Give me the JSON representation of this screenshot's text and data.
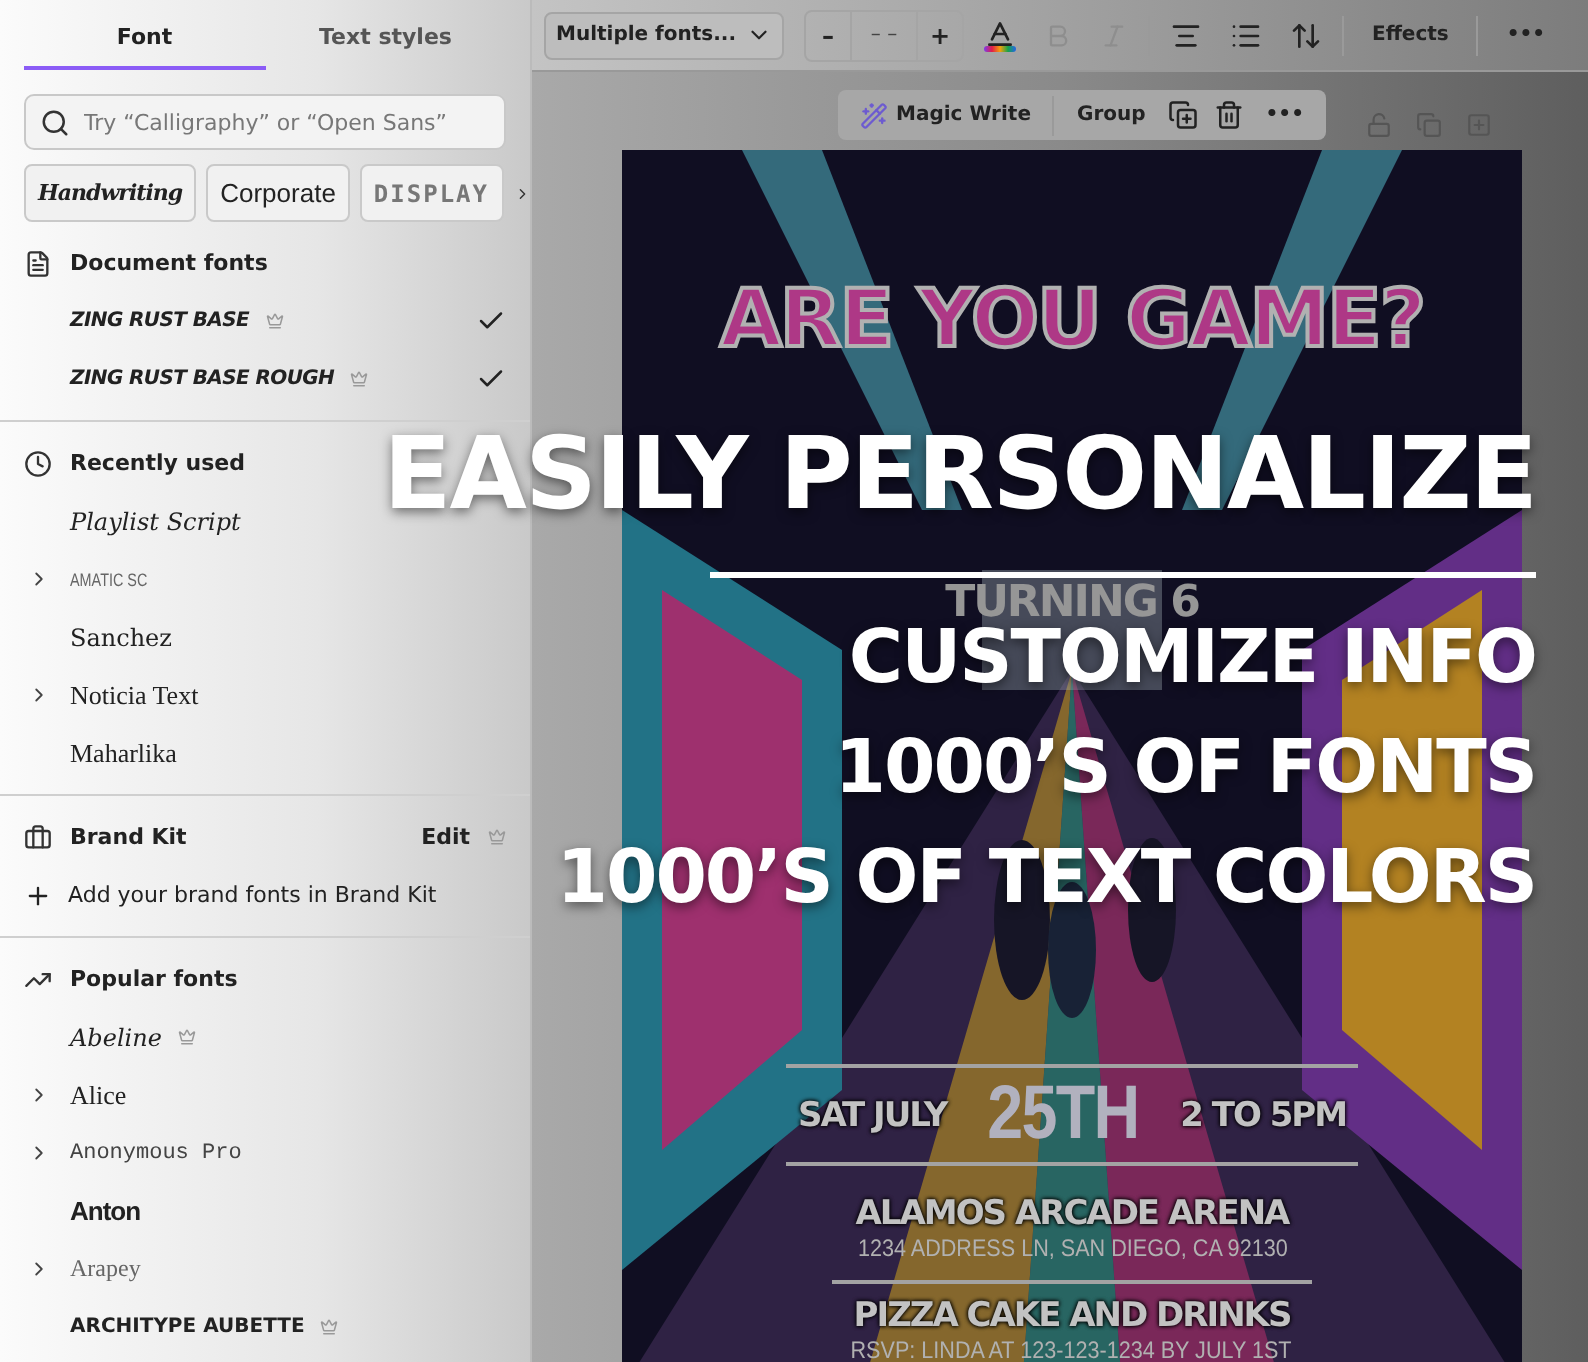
{
  "font_panel": {
    "tabs": [
      {
        "label": "Font",
        "selected": true
      },
      {
        "label": "Text styles",
        "selected": false
      }
    ],
    "search": {
      "placeholder": "Try “Calligraphy” or “Open Sans”"
    },
    "style_chips": [
      {
        "label": "Handwriting",
        "kind": "script"
      },
      {
        "label": "Corporate",
        "kind": "sans"
      },
      {
        "label": "DISPLAY",
        "kind": "display"
      }
    ],
    "sections": [
      {
        "kind": "document",
        "title": "Document fonts",
        "fonts": [
          {
            "name": "ZING RUST BASE",
            "kind": "bold-italic",
            "expandable": false,
            "premium": true,
            "checked": true
          },
          {
            "name": "ZING RUST BASE ROUGH",
            "kind": "bold-italic",
            "expandable": false,
            "premium": true,
            "checked": true
          }
        ]
      },
      {
        "kind": "recent",
        "title": "Recently used",
        "fonts": [
          {
            "name": "Playlist Script",
            "kind": "script",
            "expandable": false,
            "premium": false,
            "checked": false
          },
          {
            "name": "AMATIC SC",
            "kind": "caps-thin",
            "expandable": true,
            "premium": false,
            "checked": false
          },
          {
            "name": "Sanchez",
            "kind": "slab",
            "expandable": false,
            "premium": false,
            "checked": false
          },
          {
            "name": "Noticia Text",
            "kind": "serif",
            "expandable": true,
            "premium": false,
            "checked": false
          },
          {
            "name": "Maharlika",
            "kind": "serif",
            "expandable": false,
            "premium": false,
            "checked": false
          }
        ]
      },
      {
        "kind": "brand",
        "title": "Brand Kit",
        "action": "Edit",
        "action_premium": true,
        "add_label": "Add your brand fonts in Brand Kit"
      },
      {
        "kind": "popular",
        "title": "Popular fonts",
        "fonts": [
          {
            "name": "Abeline",
            "kind": "script",
            "expandable": false,
            "premium": true,
            "checked": false
          },
          {
            "name": "Alice",
            "kind": "serif",
            "expandable": true,
            "premium": false,
            "checked": false
          },
          {
            "name": "Anonymous Pro",
            "kind": "mono",
            "expandable": true,
            "premium": false,
            "checked": false
          },
          {
            "name": "Anton",
            "kind": "condensed",
            "expandable": false,
            "premium": false,
            "checked": false
          },
          {
            "name": "Arapey",
            "kind": "light-serif",
            "expandable": true,
            "premium": false,
            "checked": false
          },
          {
            "name": "ARCHITYPE AUBETTE",
            "kind": "display",
            "expandable": false,
            "premium": true,
            "checked": false
          }
        ]
      }
    ]
  },
  "toolbar": {
    "font_dropdown": "Multiple fonts...",
    "size_minus": "–",
    "size": {
      "placeholder": "– –"
    },
    "size_plus": "+",
    "tools": [
      {
        "kind": "text-color",
        "disabled": false
      },
      {
        "kind": "bold",
        "disabled": true
      },
      {
        "kind": "italic",
        "disabled": true
      },
      {
        "kind": "align",
        "disabled": false
      },
      {
        "kind": "list",
        "disabled": false
      },
      {
        "kind": "spacing",
        "disabled": false
      }
    ],
    "effects": "Effects",
    "more": "•••"
  },
  "selection_toolbar": {
    "magic_write": "Magic Write",
    "group": "Group",
    "more": "•••"
  },
  "poster": {
    "headline": "ARE YOU GAME?",
    "subtitle": "TURNING 6",
    "day": "SAT JULY",
    "date": "25TH",
    "time": "2 TO 5PM",
    "venue": "ALAMOS ARCADE ARENA",
    "address": "1234 ADDRESS LN, SAN DIEGO, CA 92130",
    "food": "PIZZA CAKE AND DRINKS",
    "rsvp": "RSVP: LINDA AT 123-123-1234 BY JULY 1ST"
  },
  "promo": {
    "headline": "EASILY PERSONALIZE",
    "lines": [
      "CUSTOMIZE INFO",
      "1000’S OF FONTS",
      "1000’S OF TEXT COLORS"
    ]
  }
}
